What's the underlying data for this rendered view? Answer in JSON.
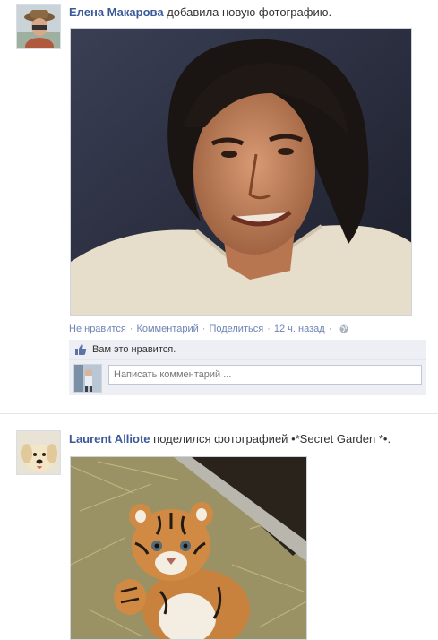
{
  "feed": {
    "post1": {
      "author": "Елена Макарова",
      "action": "добавила новую фотографию.",
      "meta": {
        "unlike": "Не нравится",
        "comment": "Комментарий",
        "share": "Поделиться",
        "time": "12 ч. назад",
        "separator": "·",
        "privacy_icon": "globe-icon"
      },
      "likes_text": "Вам это нравится.",
      "comment_placeholder": "Написать комментарий ..."
    },
    "post2": {
      "author": "Laurent Alliote",
      "action": "поделился фотографией",
      "album": "•*Secret Garden *•."
    }
  },
  "colors": {
    "link": "#3b5998",
    "meta_link": "#6d84b4",
    "likes_bg": "#edeff4"
  }
}
